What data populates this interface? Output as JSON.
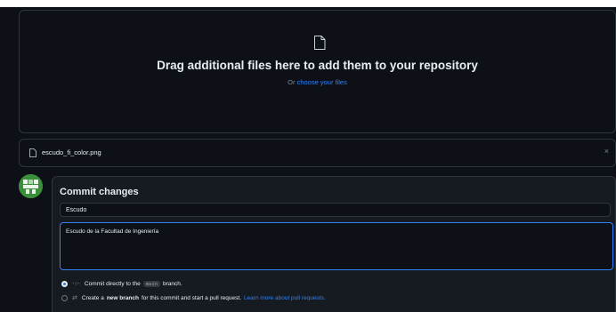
{
  "upload": {
    "title": "Drag additional files here to add them to your repository",
    "or_text": "Or",
    "choose_link": "choose your files"
  },
  "file": {
    "name": "escudo_fi_color.png",
    "remove_symbol": "×"
  },
  "commit": {
    "title": "Commit changes",
    "summary_value": "Escudo",
    "description_value": "Escudo de la Facultad de Ingeniería",
    "option_direct": {
      "prefix": "Commit directly to the",
      "branch": "main",
      "suffix": "branch."
    },
    "option_new_branch": {
      "prefix": "Create a",
      "bold": "new branch",
      "suffix": "for this commit and start a pull request.",
      "link": "Learn more about pull requests."
    }
  },
  "colors": {
    "background": "#0d1117",
    "panel": "#161b22",
    "border": "#30363d",
    "accent": "#2f81f7",
    "avatar": "#3a8f3a"
  },
  "icons": {
    "upload": "file-icon",
    "file_row": "file-icon",
    "close": "close-icon",
    "commit_direct": "git-commit-icon",
    "new_branch": "git-pull-request-icon"
  }
}
